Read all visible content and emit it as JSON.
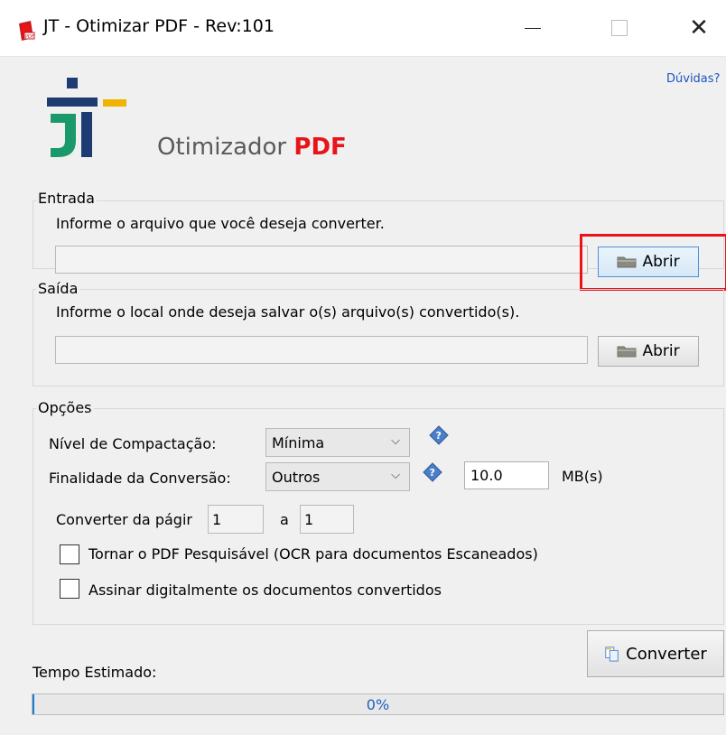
{
  "window": {
    "title": "JT - Otimizar PDF - Rev:101",
    "close_glyph": "✕"
  },
  "help_link": "Dúvidas?",
  "brand": {
    "prefix": "Otimizador",
    "highlight": "PDF"
  },
  "input_group": {
    "legend": "Entrada",
    "instruction": "Informe o arquivo que você deseja converter.",
    "file_value": "",
    "open_button": "Abrir"
  },
  "output_group": {
    "legend": "Saída",
    "instruction": "Informe o local onde deseja salvar o(s) arquivo(s) convertido(s).",
    "path_value": "",
    "open_button": "Abrir"
  },
  "options_group": {
    "legend": "Opções",
    "compression_label": "Nível de Compactação:",
    "compression_value": "Mínima",
    "purpose_label": "Finalidade da Conversão:",
    "purpose_value": "Outros",
    "size_value": "10.0",
    "size_unit": "MB(s)",
    "page_range_label": "Converter da págir",
    "page_from": "1",
    "page_to_label": "a",
    "page_to": "1",
    "ocr_label": "Tornar o PDF Pesquisável (OCR para documentos Escaneados)",
    "ocr_checked": false,
    "sign_label": "Assinar digitalmente os documentos convertidos",
    "sign_checked": false
  },
  "convert_button": "Converter",
  "estimated_time_label": "Tempo Estimado:",
  "progress": {
    "value": 0,
    "text": "0%"
  },
  "colors": {
    "accent_red": "#e8141a",
    "link_blue": "#1a55c0",
    "progress_blue": "#1f7ad8"
  }
}
